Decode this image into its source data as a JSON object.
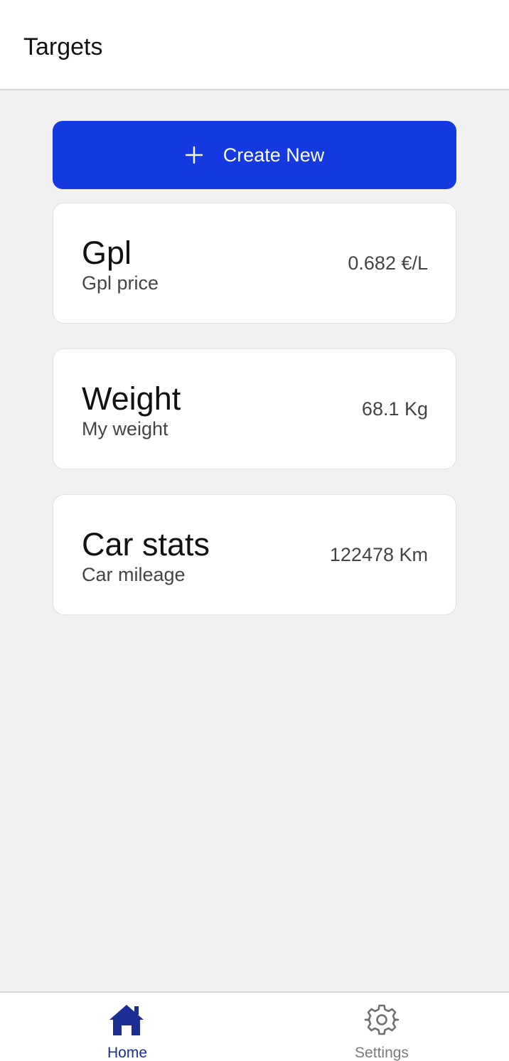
{
  "header": {
    "title": "Targets"
  },
  "actions": {
    "create_label": "Create New",
    "create_icon": "plus-icon"
  },
  "targets": [
    {
      "title": "Gpl",
      "subtitle": "Gpl price",
      "value": "0.682 €/L"
    },
    {
      "title": "Weight",
      "subtitle": "My weight",
      "value": "68.1 Kg"
    },
    {
      "title": "Car stats",
      "subtitle": "Car mileage",
      "value": "122478 Km"
    }
  ],
  "tabbar": {
    "tabs": [
      {
        "label": "Home",
        "icon": "home-icon",
        "active": true
      },
      {
        "label": "Settings",
        "icon": "gear-icon",
        "active": false
      }
    ]
  },
  "colors": {
    "accent": "#1439e0",
    "active_tab": "#1c2e94",
    "inactive_tab": "#7a7a7a",
    "background": "#f1f1f1"
  }
}
